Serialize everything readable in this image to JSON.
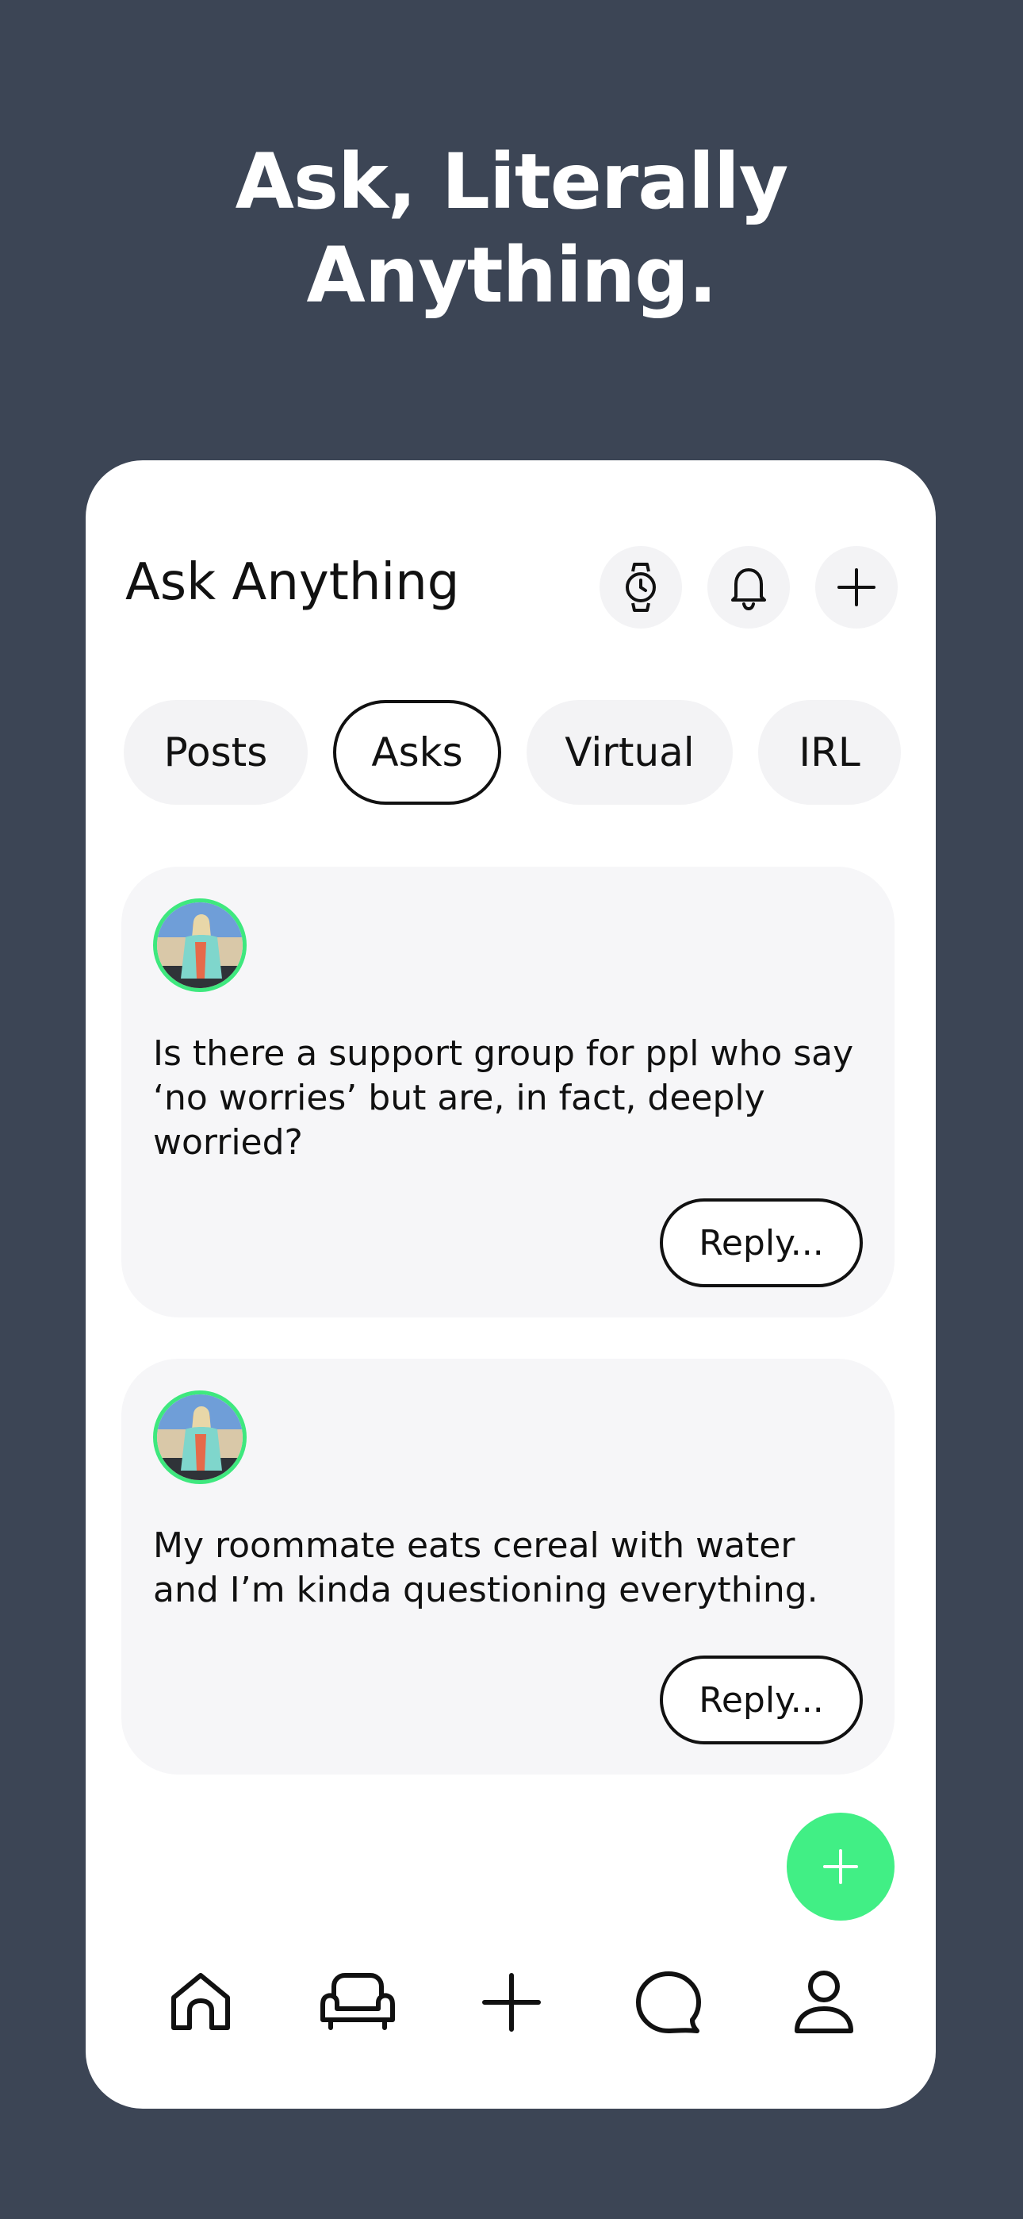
{
  "headline": {
    "line1": "Ask, Literally",
    "line2": "Anything."
  },
  "header": {
    "title": "Ask Anything",
    "buttons": [
      {
        "icon": "watch-icon"
      },
      {
        "icon": "bell-icon"
      },
      {
        "icon": "plus-icon"
      }
    ]
  },
  "tabs": [
    {
      "label": "Posts",
      "active": false
    },
    {
      "label": "Asks",
      "active": true
    },
    {
      "label": "Virtual",
      "active": false
    },
    {
      "label": "IRL",
      "active": false
    }
  ],
  "posts": [
    {
      "text": "Is there a support group for ppl who say ‘no worries’ but are, in fact, deeply worried?",
      "reply_label": "Reply..."
    },
    {
      "text": "My roommate eats cereal with water and I’m kinda questioning everything.",
      "reply_label": "Reply..."
    }
  ],
  "fab": {
    "icon": "plus-icon"
  },
  "bottom_nav": [
    {
      "icon": "home-icon"
    },
    {
      "icon": "couch-icon"
    },
    {
      "icon": "plus-icon"
    },
    {
      "icon": "chat-bubble-icon"
    },
    {
      "icon": "profile-icon"
    }
  ],
  "colors": {
    "background": "#3c4555",
    "accent": "#41ef85",
    "avatar_ring": "#3ee87e"
  }
}
